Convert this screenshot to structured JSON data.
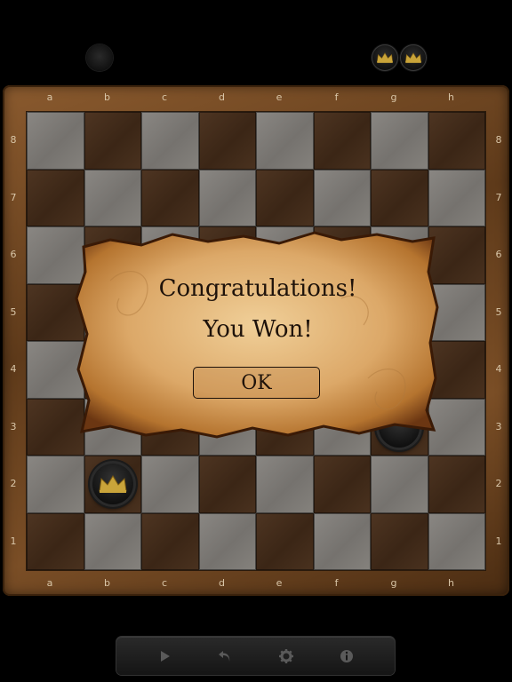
{
  "board": {
    "files": [
      "a",
      "b",
      "c",
      "d",
      "e",
      "f",
      "g",
      "h"
    ],
    "ranks": [
      "8",
      "7",
      "6",
      "5",
      "4",
      "3",
      "2",
      "1"
    ]
  },
  "dialog": {
    "line1": "Congratulations!",
    "line2": "You Won!",
    "ok_label": "OK"
  },
  "pieces": [
    {
      "color": "black",
      "type": "king",
      "square": "b2"
    },
    {
      "color": "black",
      "type": "checker",
      "square": "g3"
    }
  ],
  "captured": [
    {
      "color": "black",
      "type": "king"
    },
    {
      "color": "black",
      "type": "king"
    }
  ],
  "toolbar": {
    "icons": [
      "play-icon",
      "undo-icon",
      "gear-icon",
      "info-icon"
    ]
  },
  "colors": {
    "crown": "#c9a43a",
    "light_square": "#807d79",
    "dark_square": "#45301e",
    "frame": "#6b4420",
    "parchment": "#d9a86a"
  }
}
